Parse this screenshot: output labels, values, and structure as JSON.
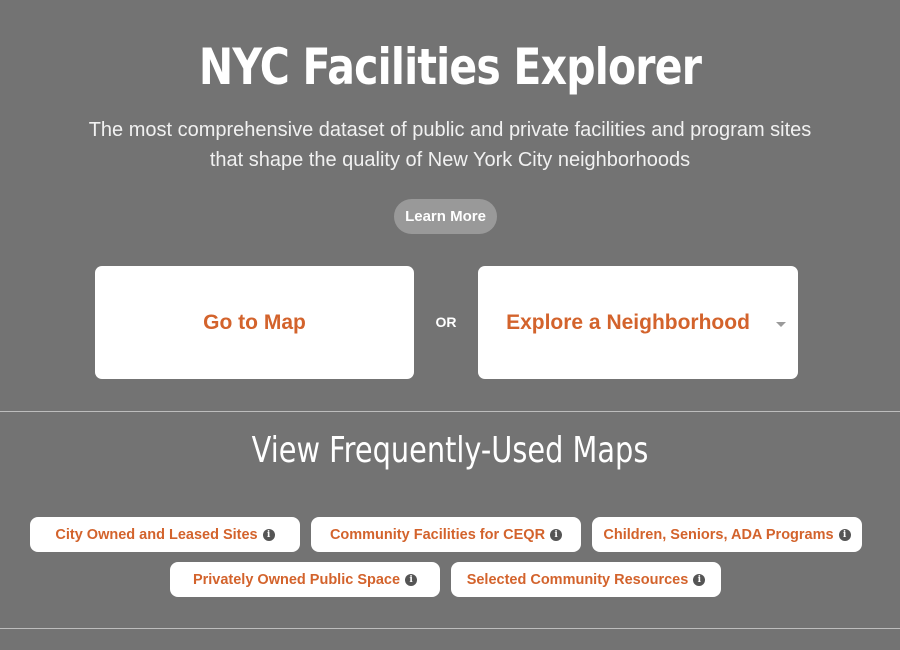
{
  "hero": {
    "title": "NYC Facilities Explorer",
    "subtitle_line1": "The most comprehensive dataset of public and private facilities and program sites",
    "subtitle_line2": "that shape the quality of New York City neighborhoods",
    "learn_more_label": "Learn More"
  },
  "cta": {
    "map_label": "Go to Map",
    "or_label": "OR",
    "neighborhood_label": "Explore a Neighborhood"
  },
  "frequent_maps": {
    "title": "View Frequently-Used Maps",
    "items": [
      {
        "label": "City Owned and Leased Sites",
        "icon": "info-icon"
      },
      {
        "label": "Community Facilities for CEQR",
        "icon": "info-icon"
      },
      {
        "label": "Children, Seniors, ADA Programs",
        "icon": "info-icon"
      },
      {
        "label": "Privately Owned Public Space",
        "icon": "info-icon"
      },
      {
        "label": "Selected Community Resources",
        "icon": "info-icon"
      }
    ]
  },
  "colors": {
    "background": "#737373",
    "accent": "#d3632c",
    "card": "#ffffff"
  }
}
